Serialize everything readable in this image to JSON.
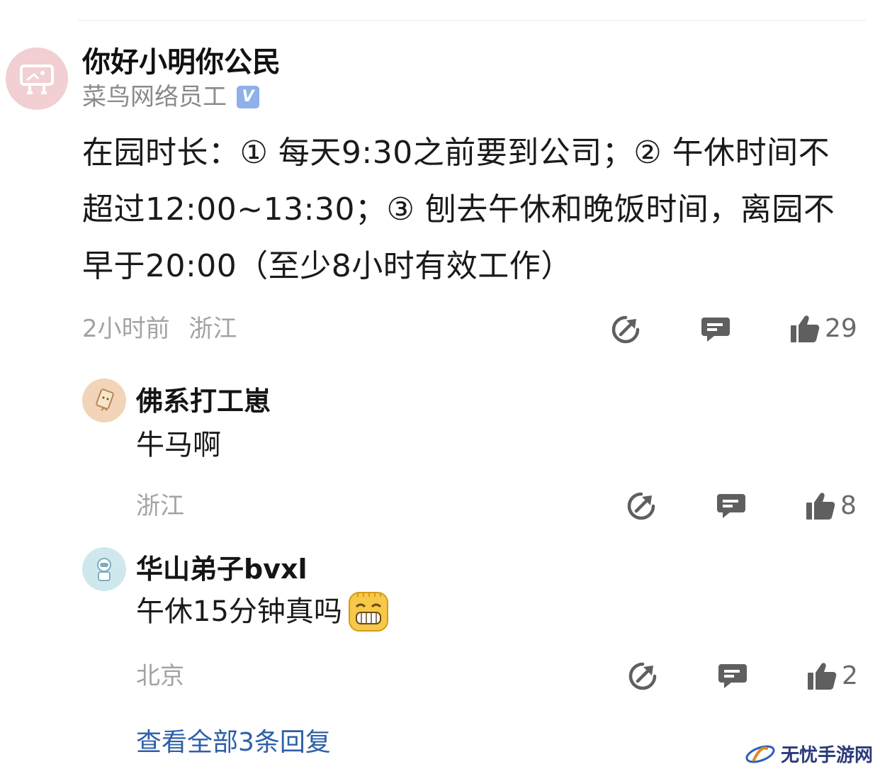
{
  "main_comment": {
    "username": "你好小明你公民",
    "user_title": "菜鸟网络员工",
    "verified_mark": "V",
    "body": "在园时长：① 每天9:30之前要到公司；② 午休时间不超过12:00~13:30；③ 刨去午休和晚饭时间，离园不早于20:00（至少8小时有效工作）",
    "time": "2小时前",
    "location": "浙江",
    "like_count": "29"
  },
  "replies": [
    {
      "username": "佛系打工崽",
      "text": "牛马啊",
      "location": "浙江",
      "like_count": "8"
    },
    {
      "username": "华山弟子bvxl",
      "text": "午休15分钟真吗",
      "location": "北京",
      "like_count": "2",
      "emoji": "grin-emoji"
    }
  ],
  "view_all_label": "查看全部3条回复",
  "watermark": {
    "text": "无忧手游网"
  },
  "icons": [
    "share-icon",
    "comment-icon",
    "thumbs-up-icon"
  ],
  "colors": {
    "link": "#2d5fa8",
    "meta_gray": "#a3a3a3",
    "icon_gray": "#5f5f5f",
    "verified": "#8fb0e8"
  }
}
